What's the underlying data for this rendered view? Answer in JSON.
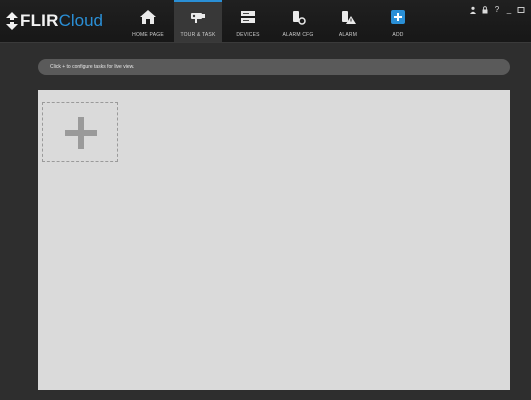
{
  "app": {
    "brand": "FLIR",
    "brand_suffix": "Cloud"
  },
  "nav": {
    "items": [
      {
        "label": "HOME PAGE",
        "icon": "home-icon",
        "active": false
      },
      {
        "label": "TOUR & TASK",
        "icon": "camera-tour-icon",
        "active": true
      },
      {
        "label": "DEVICES",
        "icon": "devices-icon",
        "active": false
      },
      {
        "label": "ALARM CFG",
        "icon": "alarm-config-icon",
        "active": false
      },
      {
        "label": "ALARM",
        "icon": "alarm-icon",
        "active": false
      },
      {
        "label": "ADD",
        "icon": "add-icon",
        "active": false
      }
    ]
  },
  "window_controls": {
    "user": "user-icon",
    "lock": "lock-icon",
    "help": "?",
    "minimize": "_",
    "maximize": "maximize-icon"
  },
  "hint": {
    "text": "Click + to configure tasks for live view."
  },
  "colors": {
    "accent": "#2a8fd6",
    "background": "#2e2e2e",
    "view_area": "#dadada"
  }
}
